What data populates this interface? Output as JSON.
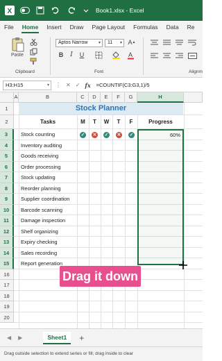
{
  "window": {
    "title": "Book1.xlsx  -  Excel",
    "brand_color": "#1f6f43"
  },
  "ribbon": {
    "tabs": [
      "File",
      "Home",
      "Insert",
      "Draw",
      "Page Layout",
      "Formulas",
      "Data",
      "Re"
    ],
    "active_tab": "Home",
    "clipboard": {
      "paste_label": "Paste",
      "group_label": "Clipboard"
    },
    "font": {
      "name": "Aptos Narrow",
      "size": "11",
      "group_label": "Font"
    },
    "alignment": {
      "group_label": "Alignm"
    }
  },
  "formula_bar": {
    "name_box": "H3:H15",
    "fx": "fx",
    "formula": "=COUNTIF(C3:G3,1)/5"
  },
  "grid": {
    "columns": [
      "A",
      "B",
      "C",
      "D",
      "E",
      "F",
      "G",
      "H"
    ],
    "rows": [
      "1",
      "2",
      "3",
      "4",
      "5",
      "6",
      "7",
      "8",
      "9",
      "10",
      "11",
      "12",
      "13",
      "14",
      "15",
      "16",
      "17",
      "18",
      "19",
      "20"
    ],
    "selected_column": "H"
  },
  "sheet": {
    "title": "Stock Planner",
    "headers": {
      "tasks": "Tasks",
      "days": [
        "M",
        "T",
        "W",
        "T",
        "F"
      ],
      "progress": "Progress"
    },
    "tasks": [
      "Stock counting",
      "Inventory auditing",
      "Goods receiving",
      "Order processing",
      "Stock updating",
      "Reorder planning",
      "Supplier coordination",
      "Barcode scanning",
      "Damage inspection",
      "Shelf organizing",
      "Expiry checking",
      "Sales recording",
      "Report generation"
    ],
    "row3_marks": [
      "check",
      "cross",
      "check",
      "cross",
      "check"
    ],
    "row3_progress": 0.6,
    "row3_progress_label": "60%",
    "colors": {
      "check": "#2e8b7a",
      "cross": "#d24c3e",
      "title": "#2f75b5",
      "title_fill": "#deeaf1"
    }
  },
  "overlay": {
    "text": "Drag it down",
    "color": "#e84f8f"
  },
  "sheet_tabs": {
    "active": "Sheet1",
    "add_label": "+"
  },
  "status_bar": {
    "text": "Drag outside selection to extend series or fill; drag inside to clear"
  }
}
